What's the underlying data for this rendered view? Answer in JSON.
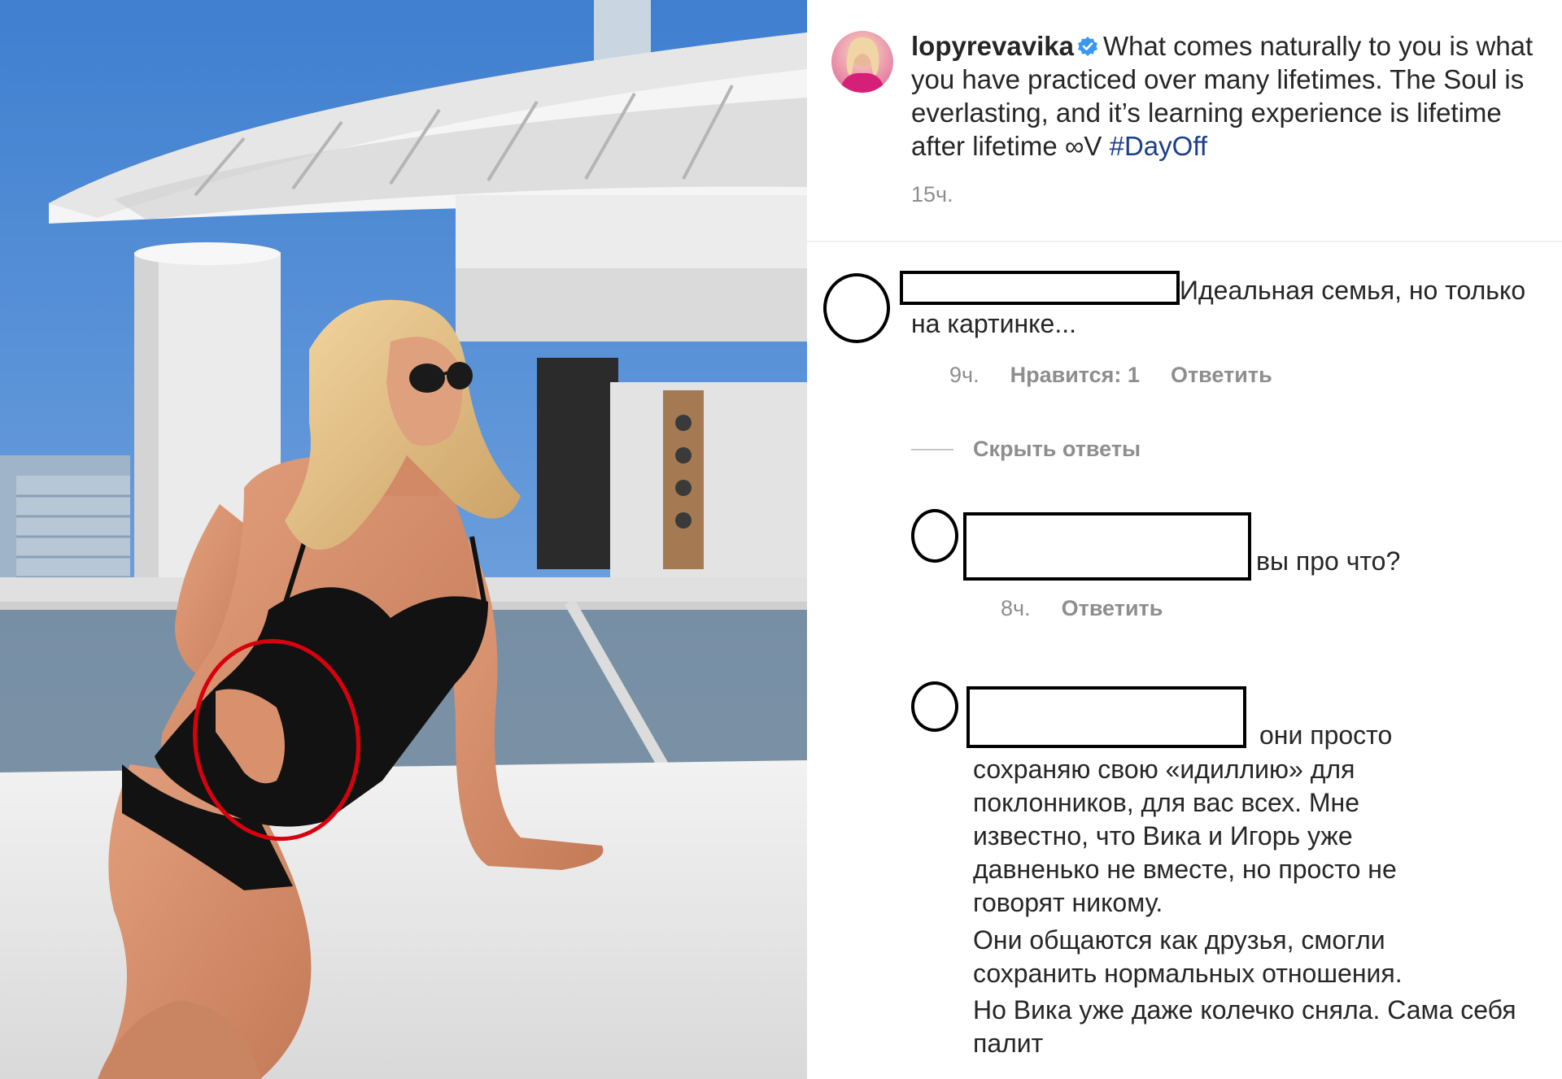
{
  "post": {
    "username": "lopyrevavika",
    "caption": "What comes naturally to you is what you have practiced over many lifetimes. The Soul is everlasting, and it’s learning experience is lifetime after lifetime ∞V",
    "hashtag": "#DayOff",
    "time": "15ч."
  },
  "comments": [
    {
      "text": "Идеальная семья, но только на картинке...",
      "time": "9ч.",
      "likes": "Нравится: 1",
      "reply": "Ответить"
    }
  ],
  "hide_replies": "Скрыть ответы",
  "replies": [
    {
      "text": "вы про что?",
      "time": "8ч.",
      "reply": "Ответить"
    },
    {
      "text_line1": "они просто",
      "paragraph1": "сохраняю свою «идиллию» для поклонников, для вас всех. Мне известно, что Вика и Игорь уже давненько не вместе, но просто не говорят никому.",
      "paragraph2": "Они общаются как друзья, смогли сохранить нормальных отношения.",
      "paragraph3": "Но Вика уже даже колечко сняла. Сама себя палит"
    }
  ],
  "colors": {
    "link": "#1b3f8b",
    "meta": "#8e8e8e",
    "verified": "#3897f0",
    "annotation_circle": "#d9000d"
  }
}
